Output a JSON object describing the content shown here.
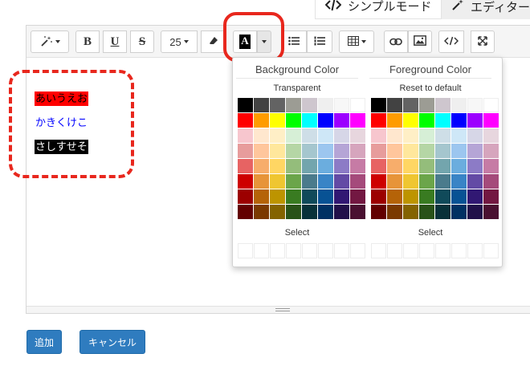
{
  "mode_tabs": {
    "simple_label": "シンプルモード",
    "editor_label": "エディター"
  },
  "toolbar": {
    "style_icon": "magic-wand-icon",
    "bold_label": "B",
    "underline_label": "U",
    "strike_label": "S",
    "font_size_value": "25",
    "text_color_label": "A"
  },
  "content": {
    "line1": {
      "text": "あいうえお",
      "color": "#000000",
      "background": "#ff0000"
    },
    "line2": {
      "text": "かきくけこ",
      "color": "#0000ff",
      "background": "transparent"
    },
    "line3": {
      "text": "さしすせそ",
      "color": "#ffffff",
      "background": "#000000"
    }
  },
  "palette": {
    "background": {
      "title": "Background Color",
      "action": "Transparent",
      "select_label": "Select"
    },
    "foreground": {
      "title": "Foreground Color",
      "action": "Reset to default",
      "select_label": "Select"
    },
    "colors": [
      [
        "#000000",
        "#424242",
        "#636363",
        "#9C9C94",
        "#CEC6CE",
        "#EFEFEF",
        "#F7F7F7",
        "#FFFFFF"
      ],
      [
        "#FF0000",
        "#FF9C00",
        "#FFFF00",
        "#00FF00",
        "#00FFFF",
        "#0000FF",
        "#9C00FF",
        "#FF00FF"
      ],
      [
        "#F7C6CE",
        "#FFE7CE",
        "#FFEFC6",
        "#D6EFD6",
        "#CEDEE7",
        "#CEE7F7",
        "#D6D6E7",
        "#E7D6DE"
      ],
      [
        "#E79C9C",
        "#FFC69C",
        "#FFE79C",
        "#B5D6A5",
        "#A5C6CE",
        "#9CC6EF",
        "#B5A5D6",
        "#D6A5BD"
      ],
      [
        "#E76363",
        "#F7AD6B",
        "#FFD663",
        "#94BD7B",
        "#73A5AD",
        "#6BADDE",
        "#8C7BC6",
        "#C67BA5"
      ],
      [
        "#CE0000",
        "#E79439",
        "#EFC631",
        "#6BA54A",
        "#4A7B8C",
        "#3984C6",
        "#634AA5",
        "#A54A7B"
      ],
      [
        "#9C0000",
        "#B56308",
        "#BD9400",
        "#397B21",
        "#104A5A",
        "#085294",
        "#311873",
        "#731842"
      ],
      [
        "#630000",
        "#7B3900",
        "#846300",
        "#295218",
        "#083139",
        "#003163",
        "#21104A",
        "#4A1031"
      ]
    ]
  },
  "buttons": {
    "add_label": "追加",
    "cancel_label": "キャンセル"
  }
}
